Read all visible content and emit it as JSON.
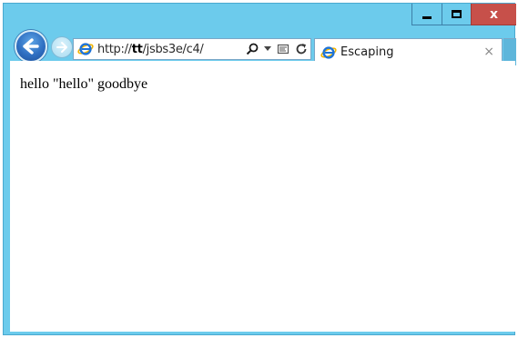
{
  "address_bar": {
    "url_prefix": "http://",
    "url_host": "tt",
    "url_path": "/jsbs3e/c4/"
  },
  "tab": {
    "title": "Escaping",
    "close_glyph": "×"
  },
  "page": {
    "text": "hello \"hello\" goodbye"
  },
  "colors": {
    "frame": "#6ccbec",
    "close_button": "#c7504a",
    "back_button": "#2f6fc2"
  },
  "icons": {
    "back": "back-arrow-icon",
    "forward": "forward-arrow-icon",
    "address": "internet-explorer-icon",
    "search": "search-icon",
    "dropdown": "chevron-down-icon",
    "compatibility": "compatibility-view-icon",
    "refresh": "refresh-icon",
    "tab": "internet-explorer-icon",
    "minimize": "minimize-icon",
    "maximize": "maximize-icon",
    "close": "close-icon"
  }
}
